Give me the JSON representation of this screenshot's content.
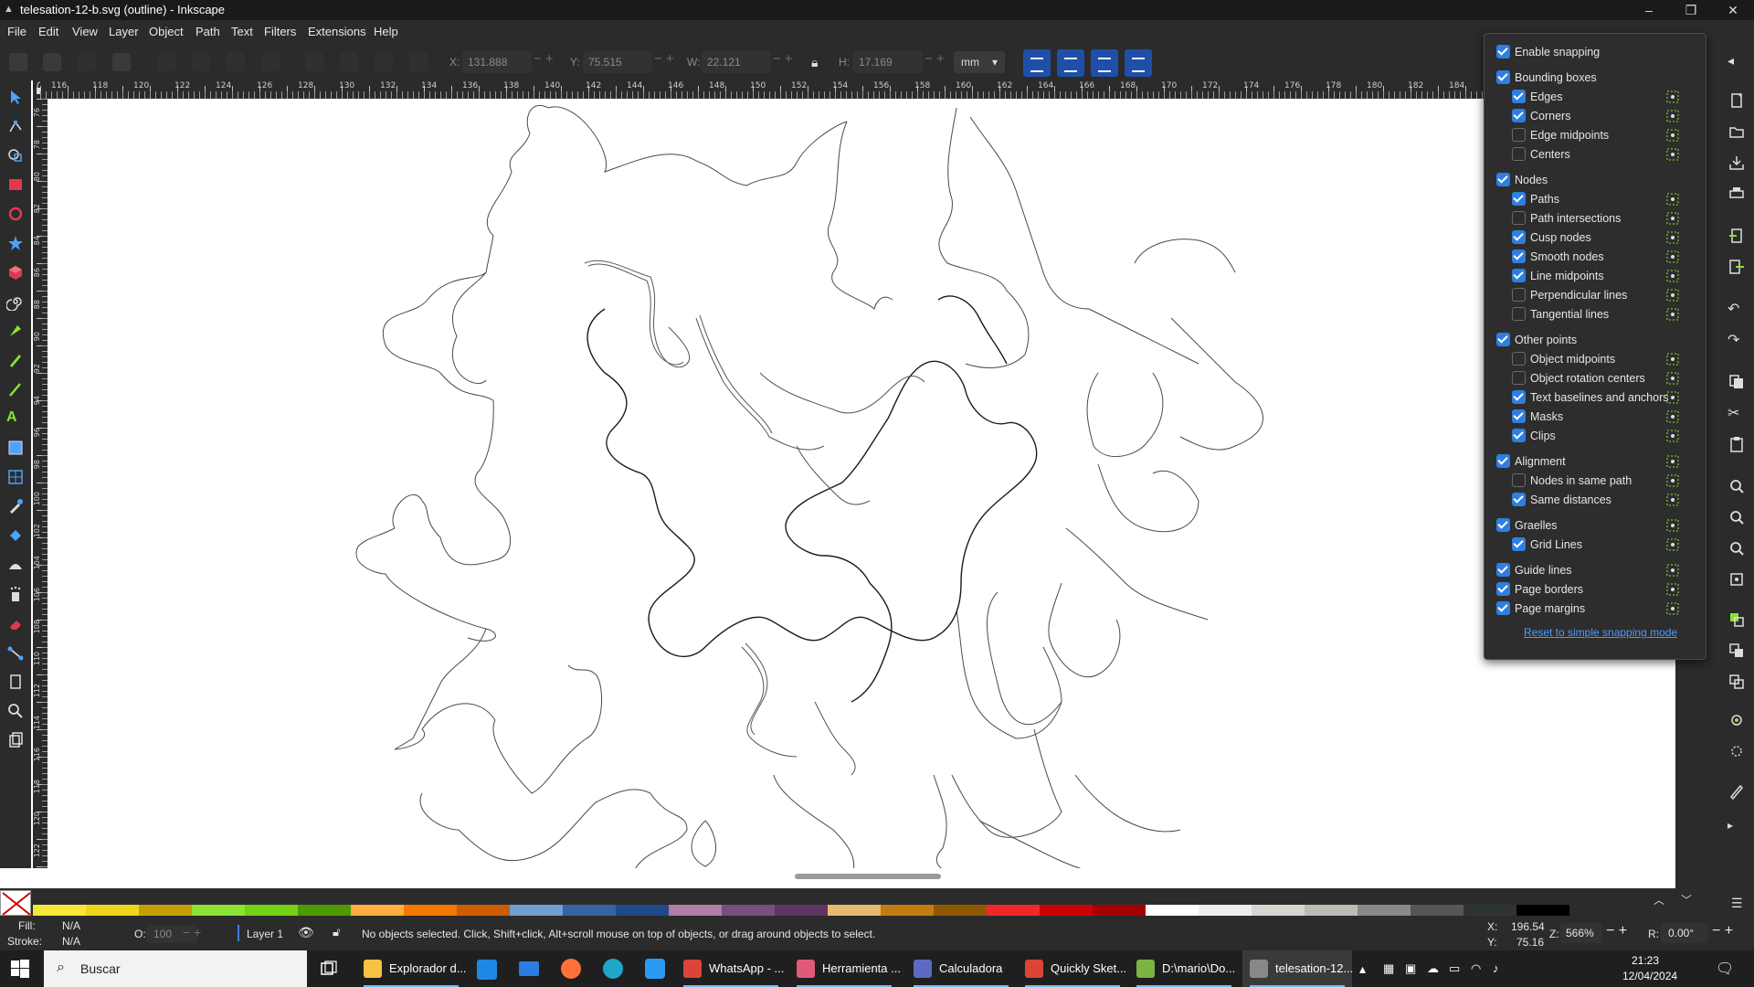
{
  "window": {
    "title": "telesation-12-b.svg (outline) - Inkscape"
  },
  "menu": [
    "File",
    "Edit",
    "View",
    "Layer",
    "Object",
    "Path",
    "Text",
    "Filters",
    "Extensions",
    "Help"
  ],
  "toolbar": {
    "x_label": "X:",
    "x_value": "131.888",
    "y_label": "Y:",
    "y_value": "75.515",
    "w_label": "W:",
    "w_value": "22.121",
    "h_label": "H:",
    "h_value": "17.169",
    "unit": "mm"
  },
  "ruler": {
    "h_labels": [
      "116",
      "118",
      "120",
      "122",
      "124",
      "126",
      "128",
      "130",
      "132",
      "134",
      "136",
      "138",
      "140",
      "142",
      "144",
      "146",
      "148",
      "150",
      "152",
      "154",
      "156",
      "158",
      "160",
      "162",
      "164",
      "166",
      "168",
      "170",
      "172",
      "174",
      "176",
      "178",
      "180",
      "182",
      "184"
    ],
    "v_labels": [
      "76",
      "78",
      "80",
      "82",
      "84",
      "86",
      "88",
      "90",
      "92",
      "94",
      "96",
      "98",
      "100",
      "102",
      "104",
      "106",
      "108",
      "110",
      "112",
      "114",
      "116",
      "118",
      "120",
      "122"
    ]
  },
  "snapping": {
    "items": [
      {
        "label": "Enable snapping",
        "checked": true,
        "level": 0,
        "icon": ""
      },
      {
        "label": "Bounding boxes",
        "checked": true,
        "level": 0,
        "icon": ""
      },
      {
        "label": "Edges",
        "checked": true,
        "level": 1,
        "icon": "bbox-edges-icon"
      },
      {
        "label": "Corners",
        "checked": true,
        "level": 1,
        "icon": "bbox-corners-icon"
      },
      {
        "label": "Edge midpoints",
        "checked": false,
        "level": 1,
        "icon": "bbox-edge-midpoints-icon"
      },
      {
        "label": "Centers",
        "checked": false,
        "level": 1,
        "icon": "bbox-centers-icon"
      },
      {
        "label": "Nodes",
        "checked": true,
        "level": 0,
        "icon": ""
      },
      {
        "label": "Paths",
        "checked": true,
        "level": 1,
        "icon": "paths-icon"
      },
      {
        "label": "Path intersections",
        "checked": false,
        "level": 1,
        "icon": "path-intersections-icon"
      },
      {
        "label": "Cusp nodes",
        "checked": true,
        "level": 1,
        "icon": "cusp-nodes-icon"
      },
      {
        "label": "Smooth nodes",
        "checked": true,
        "level": 1,
        "icon": "smooth-nodes-icon"
      },
      {
        "label": "Line midpoints",
        "checked": true,
        "level": 1,
        "icon": "line-midpoints-icon"
      },
      {
        "label": "Perpendicular lines",
        "checked": false,
        "level": 1,
        "icon": "perpendicular-lines-icon"
      },
      {
        "label": "Tangential lines",
        "checked": false,
        "level": 1,
        "icon": "tangential-lines-icon"
      },
      {
        "label": "Other points",
        "checked": true,
        "level": 0,
        "icon": ""
      },
      {
        "label": "Object midpoints",
        "checked": false,
        "level": 1,
        "icon": "object-midpoints-icon"
      },
      {
        "label": "Object rotation centers",
        "checked": false,
        "level": 1,
        "icon": "rotation-centers-icon"
      },
      {
        "label": "Text baselines and anchors",
        "checked": true,
        "level": 1,
        "icon": "text-baselines-icon"
      },
      {
        "label": "Masks",
        "checked": true,
        "level": 1,
        "icon": "masks-icon"
      },
      {
        "label": "Clips",
        "checked": true,
        "level": 1,
        "icon": "clips-icon"
      },
      {
        "label": "Alignment",
        "checked": true,
        "level": 0,
        "icon": "alignment-icon"
      },
      {
        "label": "Nodes in same path",
        "checked": false,
        "level": 1,
        "icon": "nodes-same-path-icon"
      },
      {
        "label": "Same distances",
        "checked": true,
        "level": 1,
        "icon": "same-distances-icon"
      },
      {
        "label": "Graelles",
        "checked": true,
        "level": 0,
        "icon": "grid-icon"
      },
      {
        "label": "Grid Lines",
        "checked": true,
        "level": 1,
        "icon": "grid-lines-icon"
      },
      {
        "label": "Guide lines",
        "checked": true,
        "level": 0,
        "icon": "guide-lines-icon"
      },
      {
        "label": "Page borders",
        "checked": true,
        "level": 0,
        "icon": "page-borders-icon"
      },
      {
        "label": "Page margins",
        "checked": true,
        "level": 0,
        "icon": "page-margins-icon"
      }
    ],
    "reset_link": "Reset to simple snapping mode"
  },
  "palette": {
    "colors": [
      "#f5e63a",
      "#eed51c",
      "#c4a000",
      "#8ae234",
      "#73d216",
      "#4e9a06",
      "#fcaf3e",
      "#f57900",
      "#ce5c00",
      "#729fcf",
      "#3465a4",
      "#204a87",
      "#ad7fa8",
      "#75507b",
      "#5c3566",
      "#e9b96e",
      "#c17d11",
      "#8f5902",
      "#ef2929",
      "#cc0000",
      "#a40000",
      "#ffffff",
      "#eeeeec",
      "#d3d7cf",
      "#babdb6",
      "#888a85",
      "#555753",
      "#2e3436",
      "#000000"
    ]
  },
  "status": {
    "fill_label": "Fill:",
    "fill_value": "N/A",
    "stroke_label": "Stroke:",
    "stroke_value": "N/A",
    "opacity_label": "O:",
    "opacity_value": "100",
    "layer": "Layer 1",
    "message": "No objects selected. Click, Shift+click, Alt+scroll mouse on top of objects, or drag around objects to select.",
    "x_label": "X:",
    "x_value": "196.54",
    "y_label": "Y:",
    "y_value": "75.16",
    "zoom_label": "Z:",
    "zoom_value": "566%",
    "rotation_label": "R:",
    "rotation_value": "0.00°"
  },
  "taskbar": {
    "search_placeholder": "Buscar",
    "apps": [
      {
        "name": "Explorador d...",
        "color": "#f5c242"
      },
      {
        "name": "WhatsApp - ...",
        "color": "#db4437"
      },
      {
        "name": "Herramienta ...",
        "color": "#e05a78"
      },
      {
        "name": "Calculadora",
        "color": "#5c6bc0"
      },
      {
        "name": "Quickly Sket...",
        "color": "#db4437"
      },
      {
        "name": "D:\\mario\\Do...",
        "color": "#7cb342"
      },
      {
        "name": "telesation-12...",
        "color": "#888888"
      }
    ],
    "time": "21:23",
    "date": "12/04/2024"
  }
}
